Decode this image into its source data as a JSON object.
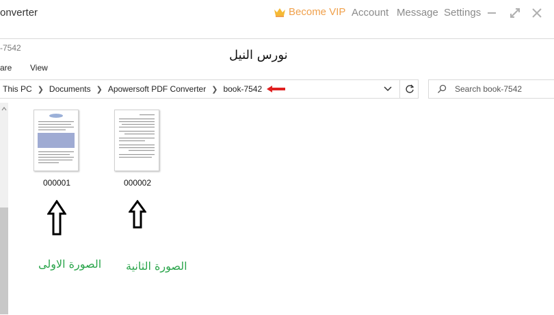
{
  "app": {
    "title": "onverter",
    "vip_label": "Become VIP",
    "account_label": "Account",
    "message_label": "Message",
    "settings_label": "Settings",
    "accent": "#f0a04b"
  },
  "explorer": {
    "window_title": "-7542",
    "ribbon": [
      "are",
      "View"
    ],
    "breadcrumbs": [
      "This PC",
      "Documents",
      "Apowersoft PDF Converter",
      "book-7542"
    ],
    "search_placeholder": "Search book-7542",
    "files": [
      {
        "name": "000001"
      },
      {
        "name": "000002"
      }
    ]
  },
  "annotations": {
    "header_text": "نورس النيل",
    "first_image_label": "الصورة الاولى",
    "second_image_label": "الصورة الثانية",
    "green": "#2aa54b",
    "red_arrow_color": "#e02020"
  },
  "icons": {
    "vip": "crown-icon",
    "minimize": "minimize-icon",
    "restore": "restore-icon",
    "close": "close-icon",
    "dropdown": "chevron-down-icon",
    "refresh": "refresh-icon",
    "search": "search-icon"
  }
}
